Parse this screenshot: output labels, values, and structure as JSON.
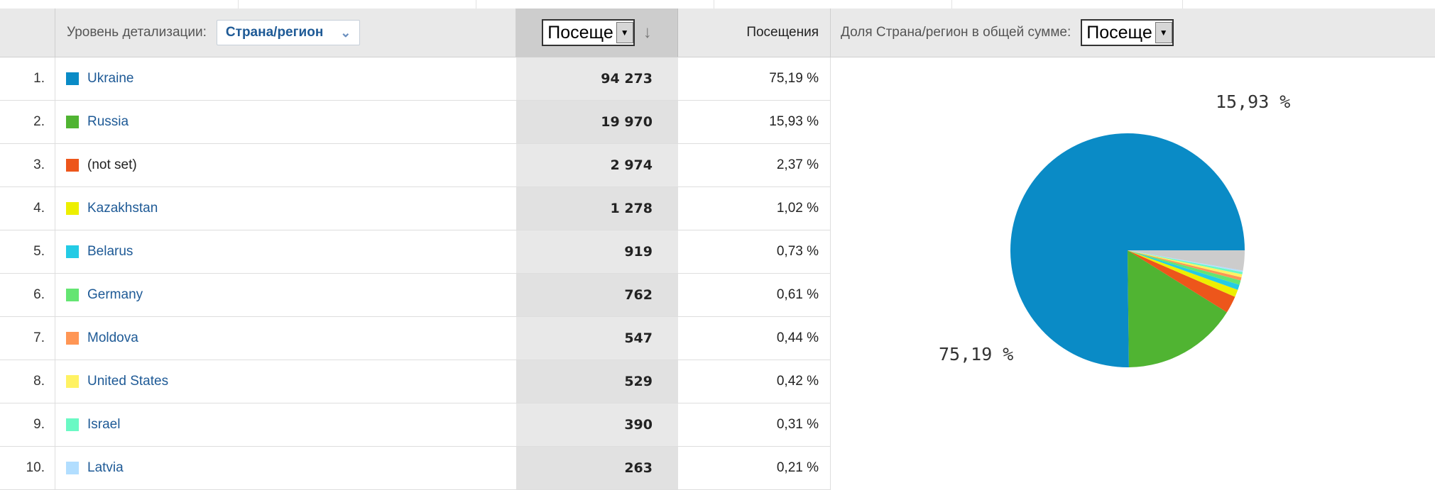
{
  "header": {
    "detail_label": "Уровень детализации:",
    "dimension_value": "Страна/регион",
    "metric_combo_value": "Посеще",
    "visits_header": "Посещения",
    "share_label": "Доля Страна/регион в общей сумме:",
    "share_combo_value": "Посеще"
  },
  "icons": {
    "dimension_chevron": "double-chevron-down-icon",
    "combo_arrow": "dropdown-arrow-icon",
    "sort": "sort-descending-arrow-icon"
  },
  "rows": [
    {
      "index": "1.",
      "country": "Ukraine",
      "color": "#0a8bc6",
      "visits": "94 273",
      "share": "75,19 %",
      "link": true
    },
    {
      "index": "2.",
      "country": "Russia",
      "color": "#50b432",
      "visits": "19 970",
      "share": "15,93 %",
      "link": true
    },
    {
      "index": "3.",
      "country": "(not set)",
      "color": "#ed561b",
      "visits": "2 974",
      "share": "2,37 %",
      "link": false
    },
    {
      "index": "4.",
      "country": "Kazakhstan",
      "color": "#edef00",
      "visits": "1 278",
      "share": "1,02 %",
      "link": true
    },
    {
      "index": "5.",
      "country": "Belarus",
      "color": "#24cbe5",
      "visits": "919",
      "share": "0,73 %",
      "link": true
    },
    {
      "index": "6.",
      "country": "Germany",
      "color": "#64e572",
      "visits": "762",
      "share": "0,61 %",
      "link": true
    },
    {
      "index": "7.",
      "country": "Moldova",
      "color": "#ff9655",
      "visits": "547",
      "share": "0,44 %",
      "link": true
    },
    {
      "index": "8.",
      "country": "United States",
      "color": "#fff263",
      "visits": "529",
      "share": "0,42 %",
      "link": true
    },
    {
      "index": "9.",
      "country": "Israel",
      "color": "#6af9c4",
      "visits": "390",
      "share": "0,31 %",
      "link": true
    },
    {
      "index": "10.",
      "country": "Latvia",
      "color": "#b2deff",
      "visits": "263",
      "share": "0,21 %",
      "link": true
    }
  ],
  "chart_data": {
    "type": "pie",
    "slices": [
      {
        "label": "Ukraine",
        "value": 75.19,
        "color": "#0a8bc6"
      },
      {
        "label": "Russia",
        "value": 15.93,
        "color": "#50b432"
      },
      {
        "label": "(not set)",
        "value": 2.37,
        "color": "#ed561b"
      },
      {
        "label": "Kazakhstan",
        "value": 1.02,
        "color": "#edef00"
      },
      {
        "label": "Belarus",
        "value": 0.73,
        "color": "#24cbe5"
      },
      {
        "label": "Germany",
        "value": 0.61,
        "color": "#64e572"
      },
      {
        "label": "Moldova",
        "value": 0.44,
        "color": "#ff9655"
      },
      {
        "label": "United States",
        "value": 0.42,
        "color": "#fff263"
      },
      {
        "label": "Israel",
        "value": 0.31,
        "color": "#6af9c4"
      },
      {
        "label": "Latvia",
        "value": 0.21,
        "color": "#b2deff"
      },
      {
        "label": "",
        "value": 2.77,
        "color": "#cccccc"
      }
    ],
    "data_labels": [
      "75,19 %",
      "15,93 %"
    ]
  }
}
